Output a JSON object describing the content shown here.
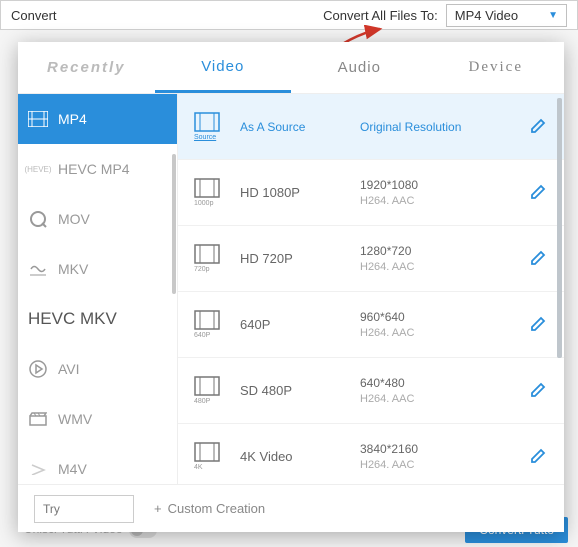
{
  "topbar": {
    "convert_label": "Convert",
    "convert_all_to": "Convert All Files To:",
    "selected_format": "MP4 Video"
  },
  "tabs": {
    "recently": "Recently",
    "video": "Video",
    "audio": "Audio",
    "device": "Device"
  },
  "sidebar": {
    "items": [
      {
        "label": "MP4"
      },
      {
        "label": "HEVC MP4",
        "sub": "(HEVE)"
      },
      {
        "label": "MOV"
      },
      {
        "label": "MKV"
      },
      {
        "label": "HEVC MKV"
      },
      {
        "label": "AVI"
      },
      {
        "label": "WMV"
      },
      {
        "label": "M4V"
      }
    ]
  },
  "presets": [
    {
      "icon_sub": "Source",
      "name": "As A Source",
      "res": "Original Resolution",
      "codec": ""
    },
    {
      "icon_sub": "1000p",
      "name": "HD 1080P",
      "res": "1920*1080",
      "codec": "H264. AAC"
    },
    {
      "icon_sub": "720p",
      "name": "HD 720P",
      "res": "1280*720",
      "codec": "H264. AAC"
    },
    {
      "icon_sub": "640P",
      "name": "640P",
      "res": "960*640",
      "codec": "H264. AAC"
    },
    {
      "icon_sub": "480P",
      "name": "SD 480P",
      "res": "640*480",
      "codec": "H264. AAC"
    },
    {
      "icon_sub": "4K",
      "name": "4K Video",
      "res": "3840*2160",
      "codec": "H264. AAC"
    }
  ],
  "footer": {
    "try": "Try",
    "custom": "Custom Creation",
    "plus": "+",
    "join": "Unisci Tutti i Video",
    "convert_all": "Converti Tutto"
  }
}
